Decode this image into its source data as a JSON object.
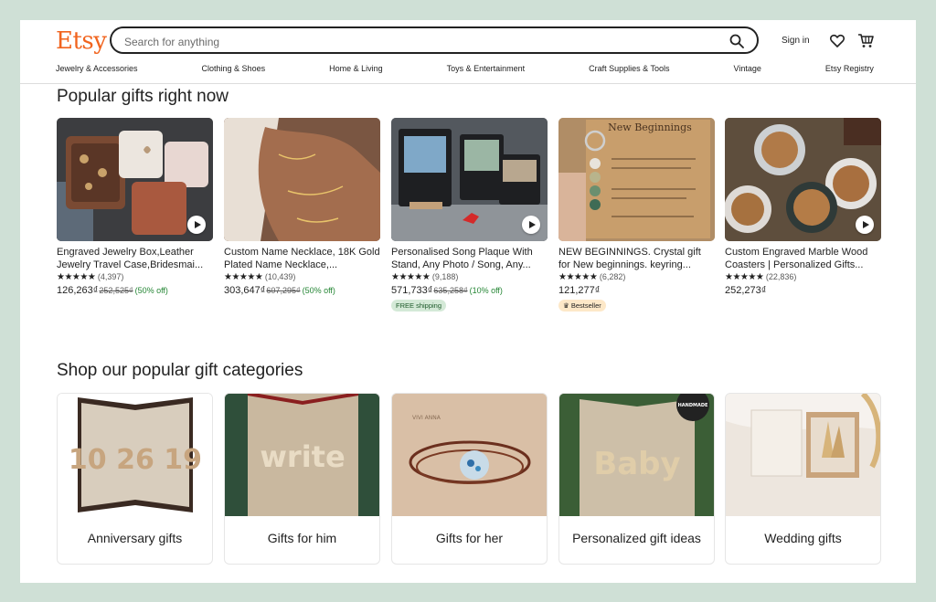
{
  "header": {
    "logo": "Etsy",
    "search_placeholder": "Search for anything",
    "signin_label": "Sign in"
  },
  "nav": [
    "Jewelry & Accessories",
    "Clothing & Shoes",
    "Home & Living",
    "Toys & Entertainment",
    "Craft Supplies & Tools",
    "Vintage",
    "Etsy Registry"
  ],
  "popular_title": "Popular gifts right now",
  "products": [
    {
      "title": "Engraved Jewelry Box,Leather Jewelry Travel Case,Bridesmai...",
      "stars": "★★★★★",
      "reviews": "(4,397)",
      "price": "126,263₫",
      "orig": "252,525₫",
      "disc": "(50% off)",
      "badge": ""
    },
    {
      "title": "Custom Name Necklace, 18K Gold Plated Name Necklace,...",
      "stars": "★★★★★",
      "reviews": "(10,439)",
      "price": "303,647₫",
      "orig": "607,295₫",
      "disc": "(50% off)",
      "badge": ""
    },
    {
      "title": "Personalised Song Plaque With Stand, Any Photo / Song, Any...",
      "stars": "★★★★★",
      "reviews": "(9,188)",
      "price": "571,733₫",
      "orig": "635,258₫",
      "disc": "(10% off)",
      "badge": "FREE shipping"
    },
    {
      "title": "NEW BEGINNINGS. Crystal gift for New beginnings. keyring...",
      "stars": "★★★★★",
      "reviews": "(6,282)",
      "price": "121,277₫",
      "orig": "",
      "disc": "",
      "badge": "Bestseller"
    },
    {
      "title": "Custom Engraved Marble Wood Coasters | Personalized Gifts...",
      "stars": "★★★★★",
      "reviews": "(22,836)",
      "price": "252,273₫",
      "orig": "",
      "disc": "",
      "badge": ""
    }
  ],
  "categories_title": "Shop our popular gift categories",
  "categories": [
    {
      "label": "Anniversary gifts"
    },
    {
      "label": "Gifts for him"
    },
    {
      "label": "Gifts for her"
    },
    {
      "label": "Personalized gift ideas"
    },
    {
      "label": "Wedding gifts"
    }
  ],
  "image_text": {
    "plaque_title": "New Beginnings",
    "anniv_book": "10 26 19",
    "him_book": "write",
    "her_watermark": "VIVI ANNA",
    "baby_book": "Baby",
    "handmade_seal": "HANDMADE"
  },
  "colors": {
    "brand": "#f1641e",
    "background": "#cfe0d6",
    "discount": "#258635"
  }
}
